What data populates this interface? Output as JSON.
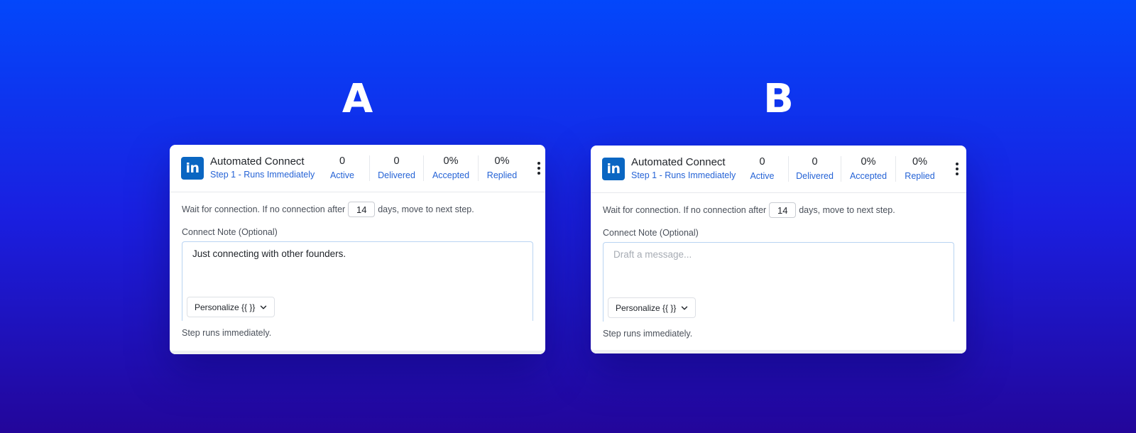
{
  "labels": {
    "a": "A",
    "b": "B"
  },
  "cards": [
    {
      "icon": "linkedin-icon",
      "logo_text": "in",
      "title": "Automated Connect",
      "subtitle": "Step 1 - Runs Immediately",
      "stats": [
        {
          "value": "0",
          "label": "Active"
        },
        {
          "value": "0",
          "label": "Delivered"
        },
        {
          "value": "0%",
          "label": "Accepted"
        },
        {
          "value": "0%",
          "label": "Replied"
        }
      ],
      "wait_prefix": "Wait for connection. If no connection after",
      "wait_days": "14",
      "wait_suffix": "days, move to next step.",
      "note_label": "Connect Note (Optional)",
      "note_value": "Just connecting with other founders.",
      "note_placeholder": "",
      "personalize_label": "Personalize {{ }}",
      "step_note": "Step runs immediately."
    },
    {
      "icon": "linkedin-icon",
      "logo_text": "in",
      "title": "Automated Connect",
      "subtitle": "Step 1 - Runs Immediately",
      "stats": [
        {
          "value": "0",
          "label": "Active"
        },
        {
          "value": "0",
          "label": "Delivered"
        },
        {
          "value": "0%",
          "label": "Accepted"
        },
        {
          "value": "0%",
          "label": "Replied"
        }
      ],
      "wait_prefix": "Wait for connection. If no connection after",
      "wait_days": "14",
      "wait_suffix": "days, move to next step.",
      "note_label": "Connect Note (Optional)",
      "note_value": "",
      "note_placeholder": "Draft a message...",
      "personalize_label": "Personalize {{ }}",
      "step_note": "Step runs immediately."
    }
  ],
  "colors": {
    "linkedin_blue": "#0a66c2",
    "accent_blue": "#2563d6",
    "background_top": "#0347fb",
    "background_bottom": "#23069a"
  }
}
